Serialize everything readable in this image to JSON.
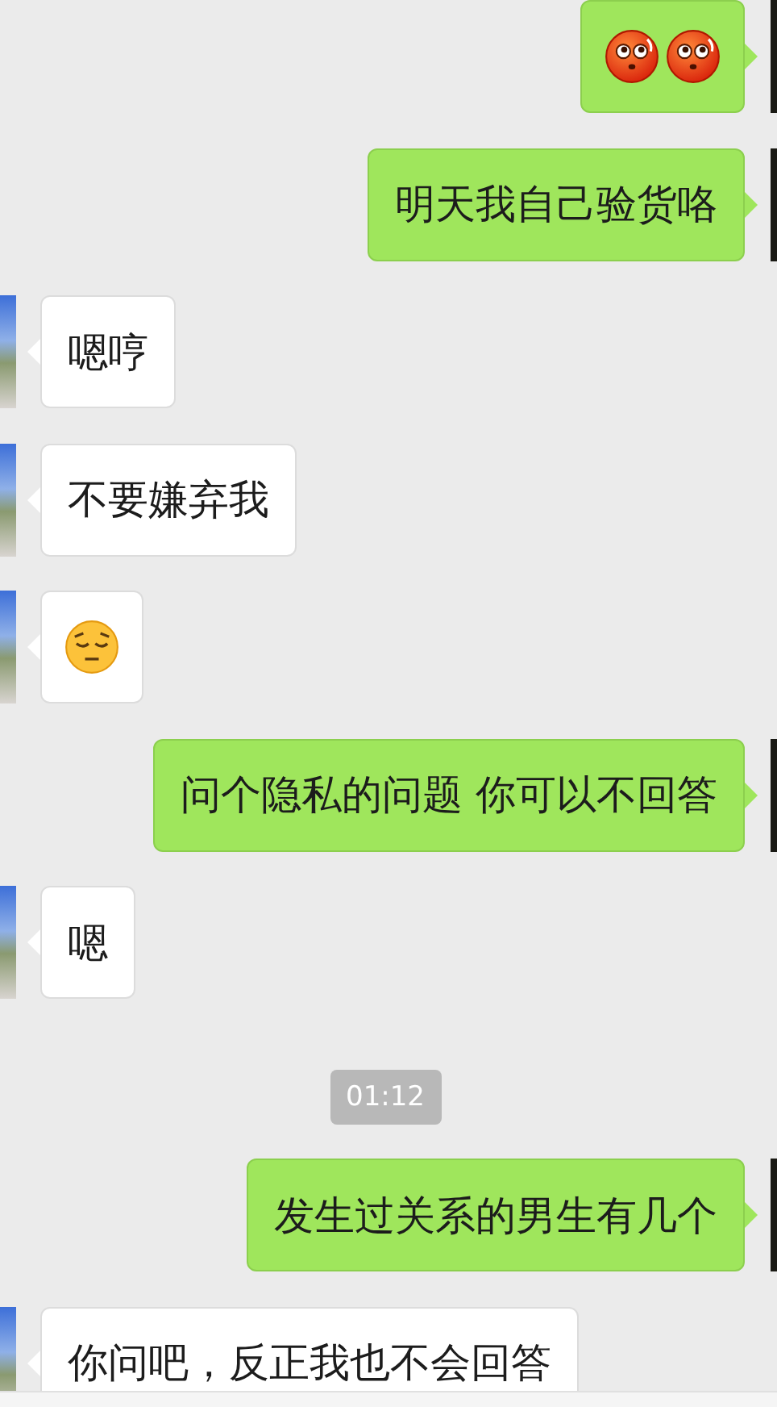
{
  "messages": [
    {
      "kind": "sent",
      "stickers": [
        {
          "kind": "flushed"
        },
        {
          "kind": "flushed"
        }
      ]
    },
    {
      "kind": "sent",
      "text": "明天我自己验货咯"
    },
    {
      "kind": "received",
      "text": "嗯哼"
    },
    {
      "kind": "received",
      "text": "不要嫌弃我"
    },
    {
      "kind": "received",
      "stickers": [
        {
          "kind": "pensive"
        }
      ]
    },
    {
      "kind": "sent",
      "text": "问个隐私的问题 你可以不回答"
    },
    {
      "kind": "received",
      "text": "嗯"
    },
    {
      "kind": "time",
      "text": "01:12"
    },
    {
      "kind": "sent",
      "text": "发生过关系的男生有几个"
    },
    {
      "kind": "received",
      "text": "你问吧，反正我也不会回答"
    }
  ]
}
